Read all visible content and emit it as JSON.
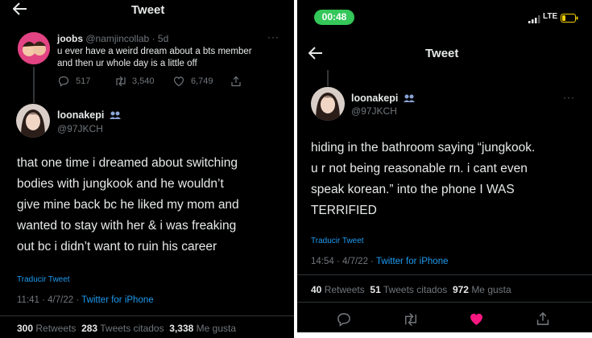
{
  "left": {
    "header_title": "Tweet",
    "reply": {
      "name": "joobs",
      "handle": "@namjincollab",
      "time": "· 5d",
      "text_line1": "u ever have a weird dream about a bts member",
      "text_line2": "and then ur whole day is a little off",
      "replies": "517",
      "retweets": "3,540",
      "likes": "6,749"
    },
    "main": {
      "name": "loonakepi",
      "handle": "@97JKCH",
      "lines": [
        "that one time i dreamed about switching",
        "bodies with jungkook and he wouldn’t",
        "give mine back bc he liked my mom and",
        "wanted to stay with her & i was freaking",
        "out bc i didn’t want to ruin his career"
      ],
      "translate": "Traducir Tweet",
      "time": "11:41 · 4/7/22 ·",
      "source": "Twitter for iPhone",
      "retweets_num": "300",
      "retweets_label": "Retweets",
      "quotes_num": "283",
      "quotes_label": "Tweets citados",
      "likes_num": "3,338",
      "likes_label": "Me gusta"
    }
  },
  "right": {
    "status": {
      "clock": "00:48",
      "network": "LTE"
    },
    "header_title": "Tweet",
    "main": {
      "name": "loonakepi",
      "handle": "@97JKCH",
      "lines": [
        "hiding in the bathroom saying “jungkook.",
        "u r not being reasonable rn. i cant even",
        "speak korean.” into the phone I WAS",
        "TERRIFIED"
      ],
      "translate": "Traducir Tweet",
      "time": "14:54 · 4/7/22 ·",
      "source": "Twitter for iPhone",
      "retweets_num": "40",
      "retweets_label": "Retweets",
      "quotes_num": "51",
      "quotes_label": "Tweets citados",
      "likes_num": "972",
      "likes_label": "Me gusta"
    }
  },
  "colors": {
    "background": "#000000",
    "text": "#e7e9ea",
    "muted": "#71767b",
    "link": "#1d9bf0",
    "like": "#f91880",
    "clock_pill": "#34c759"
  }
}
